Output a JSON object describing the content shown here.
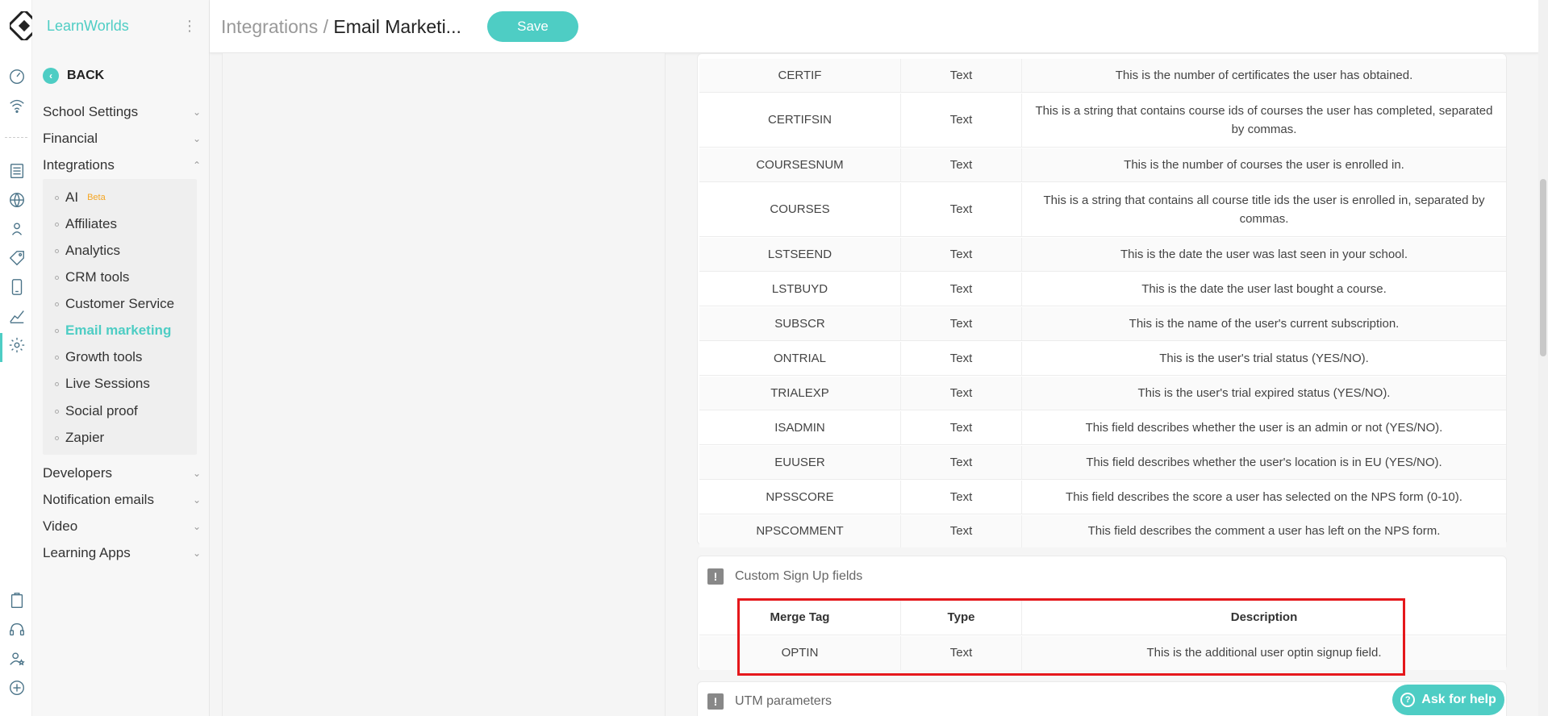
{
  "brand": "LearnWorlds",
  "header": {
    "crumb_parent": "Integrations",
    "crumb_sep": " / ",
    "crumb_current": "Email Marketi...",
    "save_label": "Save"
  },
  "sidebar": {
    "back_label": "BACK",
    "sections_top": [
      "School Settings",
      "Financial",
      "Integrations"
    ],
    "integrations_items": [
      "AI",
      "Affiliates",
      "Analytics",
      "CRM tools",
      "Customer Service",
      "Email marketing",
      "Growth tools",
      "Live Sessions",
      "Social proof",
      "Zapier"
    ],
    "ai_badge": "Beta",
    "sections_bottom": [
      "Developers",
      "Notification emails",
      "Video",
      "Learning Apps"
    ]
  },
  "table": {
    "rows": [
      {
        "tag": "CERTIF",
        "type": "Text",
        "desc": "This is the number of certificates the user has obtained."
      },
      {
        "tag": "CERTIFSIN",
        "type": "Text",
        "desc": "This is a string that contains course ids of courses the user has completed, separated by commas."
      },
      {
        "tag": "COURSESNUM",
        "type": "Text",
        "desc": "This is the number of courses the user is enrolled in."
      },
      {
        "tag": "COURSES",
        "type": "Text",
        "desc": "This is a string that contains all course title ids the user is enrolled in, separated by commas."
      },
      {
        "tag": "LSTSEEND",
        "type": "Text",
        "desc": "This is the date the user was last seen in your school."
      },
      {
        "tag": "LSTBUYD",
        "type": "Text",
        "desc": "This is the date the user last bought a course."
      },
      {
        "tag": "SUBSCR",
        "type": "Text",
        "desc": "This is the name of the user's current subscription."
      },
      {
        "tag": "ONTRIAL",
        "type": "Text",
        "desc": "This is the user's trial status (YES/NO)."
      },
      {
        "tag": "TRIALEXP",
        "type": "Text",
        "desc": "This is the user's trial expired status (YES/NO)."
      },
      {
        "tag": "ISADMIN",
        "type": "Text",
        "desc": "This field describes whether the user is an admin or not (YES/NO)."
      },
      {
        "tag": "EUUSER",
        "type": "Text",
        "desc": "This field describes whether the user's location is in EU (YES/NO)."
      },
      {
        "tag": "NPSSCORE",
        "type": "Text",
        "desc": "This field describes the score a user has selected on the NPS form (0-10)."
      },
      {
        "tag": "NPSCOMMENT",
        "type": "Text",
        "desc": "This field describes the comment a user has left on the NPS form."
      }
    ]
  },
  "custom_signup": {
    "title": "Custom Sign Up fields",
    "headers": {
      "tag": "Merge Tag",
      "type": "Type",
      "desc": "Description"
    },
    "row": {
      "tag": "OPTIN",
      "type": "Text",
      "desc": "This is the additional user optin signup field."
    }
  },
  "utm": {
    "title": "UTM parameters"
  },
  "help": {
    "label": "Ask for help"
  },
  "colors": {
    "accent": "#4ecdc4",
    "highlight": "#e5171b",
    "rail_icon": "#4a7388"
  }
}
